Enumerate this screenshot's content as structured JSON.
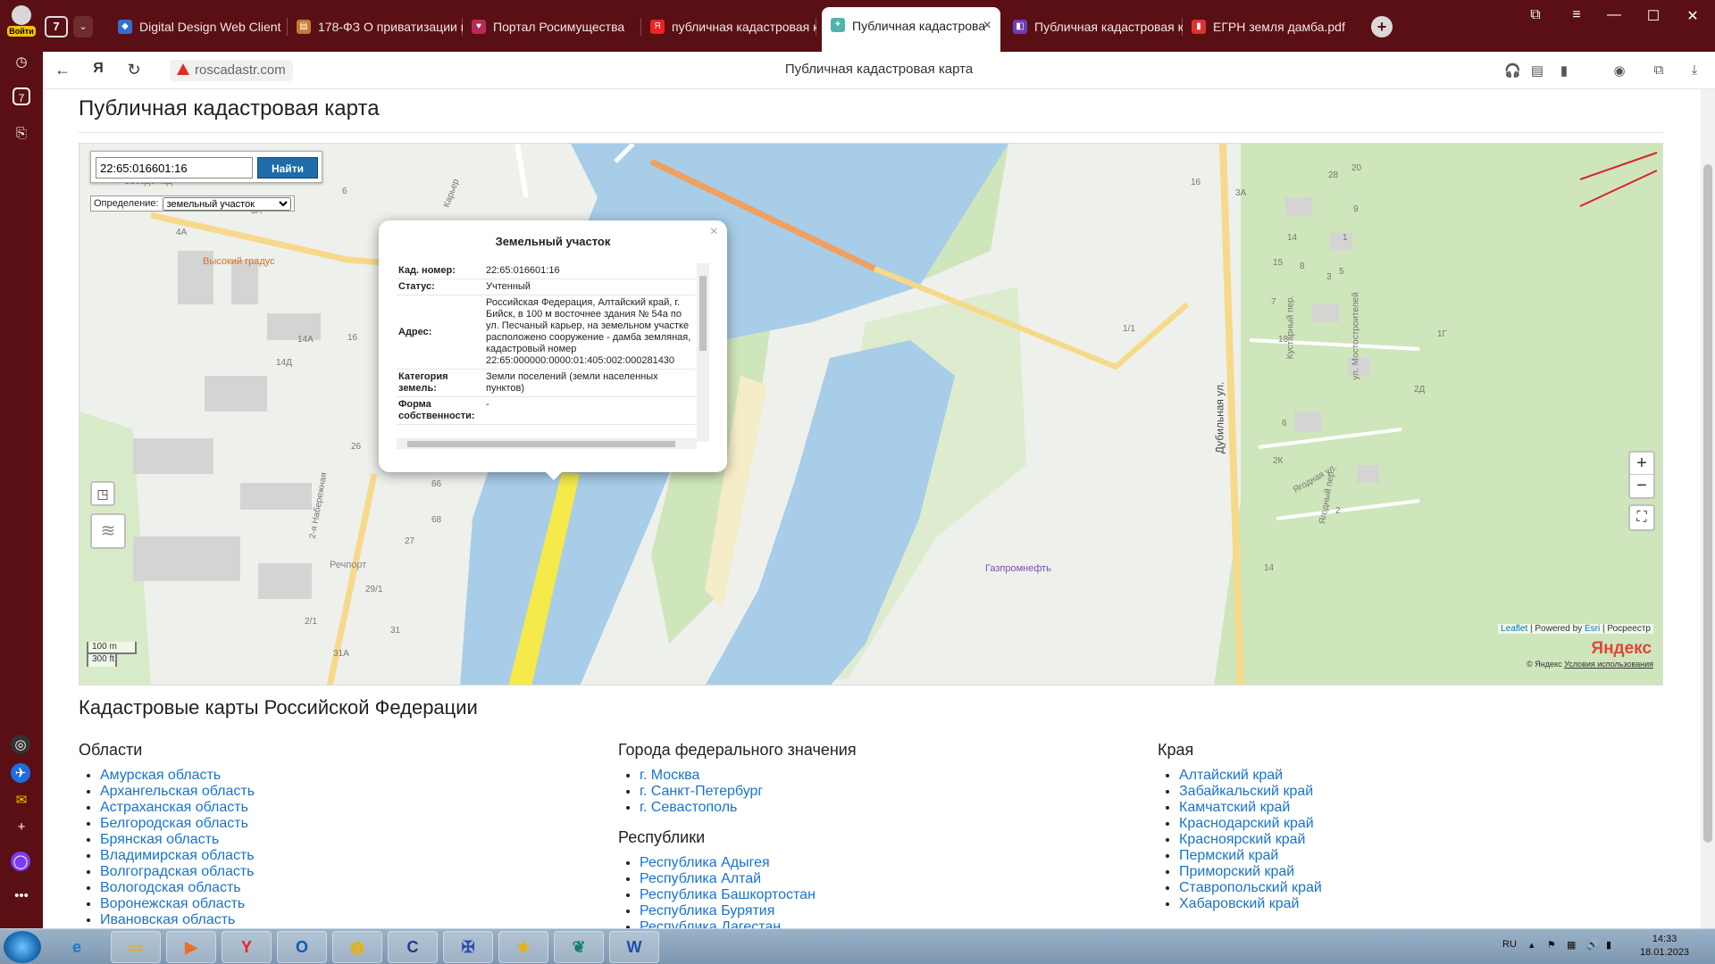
{
  "browser": {
    "profile_login": "Войти",
    "tab_count": "7",
    "tabs": [
      {
        "label": "Digital Design Web Client"
      },
      {
        "label": "178-ФЗ О приватизации г"
      },
      {
        "label": "Портал Росимущества"
      },
      {
        "label": "публичная кадастровая к"
      },
      {
        "label": "Публичная кадастрова"
      },
      {
        "label": "Публичная кадастровая к"
      },
      {
        "label": "ЕГРН земля дамба.pdf"
      }
    ],
    "url": "roscadastr.com",
    "page_title": "Публичная кадастровая карта",
    "sidebar_badge": "7"
  },
  "page": {
    "heading": "Публичная кадастровая карта"
  },
  "map": {
    "search_value": "22:65:016601:16",
    "search_button": "Найти",
    "definition_label": "Определение:",
    "definition_value": "земельный участок",
    "poi_labels": [
      "Звездопад",
      "Высокий градус",
      "Газпромнефть",
      "Речпорт"
    ],
    "street_labels": [
      "Карьер",
      "2-я Набережная",
      "Дубильная ул.",
      "ул. Мостостроителей",
      "Кустарный пер.",
      "Ягодная ул.",
      "Ягодный пер."
    ],
    "house_numbers": [
      "6",
      "4",
      "3А",
      "4А",
      "14А",
      "14Д",
      "16",
      "26",
      "66",
      "68",
      "27",
      "29/1",
      "31",
      "31А",
      "2/1",
      "1/1",
      "1Г",
      "16",
      "3А",
      "28",
      "20",
      "14",
      "15",
      "9",
      "8",
      "7",
      "18",
      "2Д",
      "2К",
      "6",
      "2",
      "14",
      "3",
      "5",
      "1"
    ],
    "popup": {
      "title": "Земельный участок",
      "rows": [
        {
          "key": "Кад. номер:",
          "value": "22:65:016601:16"
        },
        {
          "key": "Статус:",
          "value": "Учтенный"
        },
        {
          "key": "Адрес:",
          "value": "Российская Федерация, Алтайский край, г. Бийск, в 100 м восточнее здания № 54а по ул. Песчаный карьер, на земельном участке расположено сооружение - дамба земляная, кадастровый номер 22:65:000000:0000:01:405:002:000281430"
        },
        {
          "key": "Категория земель:",
          "value": "Земли поселений (земли населенных пунктов)"
        },
        {
          "key": "Форма собственности:",
          "value": "-"
        }
      ]
    },
    "zoom_in": "+",
    "zoom_out": "−",
    "attribution_leaflet": "Leaflet",
    "attribution_powered": "| Powered by",
    "attribution_esri": "Esri",
    "attribution_rosreestr": "| Росреестр",
    "yandex_logo": "Яндекс",
    "yandex_copyright": "© Яндекс",
    "yandex_terms": "Условия использования",
    "scale_m": "100 m",
    "scale_ft": "300 ft"
  },
  "lists": {
    "heading": "Кадастровые карты Российской Федерации",
    "regions_title": "Области",
    "regions": [
      "Амурская область",
      "Архангельская область",
      "Астраханская область",
      "Белгородская область",
      "Брянская область",
      "Владимирская область",
      "Волгоградская область",
      "Вологодская область",
      "Воронежская область",
      "Ивановская область"
    ],
    "federal_title": "Города федерального значения",
    "federal": [
      "г. Москва",
      "г. Санкт-Петербург",
      "г. Севастополь"
    ],
    "republics_title": "Республики",
    "republics": [
      "Республика Адыгея",
      "Республика Алтай",
      "Республика Башкортостан",
      "Республика Бурятия",
      "Республика Дагестан"
    ],
    "krai_title": "Края",
    "krai": [
      "Алтайский край",
      "Забайкальский край",
      "Камчатский край",
      "Краснодарский край",
      "Красноярский край",
      "Пермский край",
      "Приморский край",
      "Ставропольский край",
      "Хабаровский край"
    ]
  },
  "taskbar": {
    "lang": "RU",
    "time": "14:33",
    "date": "18.01.2023"
  },
  "colors": {
    "browser_frame": "#5a0f14",
    "river": "#a8cde8",
    "green": "#d4e8c2",
    "link": "#1a73c8",
    "search_button": "#1e6ca8"
  }
}
